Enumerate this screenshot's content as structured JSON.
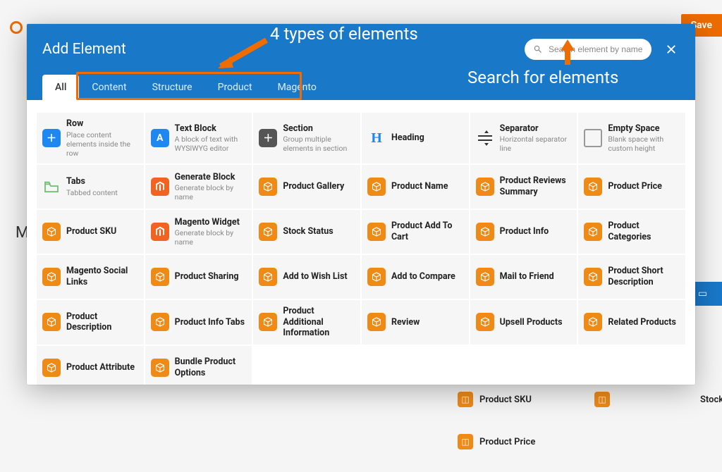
{
  "bg": {
    "save_label": "Save",
    "letter": "M",
    "items": [
      "Product SKU",
      "Stock",
      "Product Price"
    ]
  },
  "modal": {
    "title": "Add Element",
    "search_placeholder": "Search element by name",
    "tabs": [
      {
        "label": "All"
      },
      {
        "label": "Content"
      },
      {
        "label": "Structure"
      },
      {
        "label": "Product"
      },
      {
        "label": "Magento"
      }
    ]
  },
  "annotations": {
    "types_label": "4 types of elements",
    "search_label": "Search for elements"
  },
  "elements": [
    {
      "icon": "plus-blue",
      "title": "Row",
      "sub": "Place content elements inside the row"
    },
    {
      "icon": "A-blue",
      "title": "Text Block",
      "sub": "A block of text with WYSIWYG editor"
    },
    {
      "icon": "plus-dark",
      "title": "Section",
      "sub": "Group multiple elements in section"
    },
    {
      "icon": "H",
      "title": "Heading",
      "sub": ""
    },
    {
      "icon": "separator",
      "title": "Separator",
      "sub": "Horizontal separator line"
    },
    {
      "icon": "outline",
      "title": "Empty Space",
      "sub": "Blank space with custom height"
    },
    {
      "icon": "folder",
      "title": "Tabs",
      "sub": "Tabbed content"
    },
    {
      "icon": "magento",
      "title": "Generate Block",
      "sub": "Generate block by name"
    },
    {
      "icon": "box",
      "title": "Product Gallery",
      "sub": ""
    },
    {
      "icon": "box",
      "title": "Product Name",
      "sub": ""
    },
    {
      "icon": "box",
      "title": "Product Reviews Summary",
      "sub": ""
    },
    {
      "icon": "box",
      "title": "Product Price",
      "sub": ""
    },
    {
      "icon": "box",
      "title": "Product SKU",
      "sub": ""
    },
    {
      "icon": "magento",
      "title": "Magento Widget",
      "sub": "Generate block by name"
    },
    {
      "icon": "box",
      "title": "Stock Status",
      "sub": ""
    },
    {
      "icon": "box",
      "title": "Product Add To Cart",
      "sub": ""
    },
    {
      "icon": "box",
      "title": "Product Info",
      "sub": ""
    },
    {
      "icon": "box",
      "title": "Product Categories",
      "sub": ""
    },
    {
      "icon": "box",
      "title": "Magento Social Links",
      "sub": ""
    },
    {
      "icon": "box",
      "title": "Product Sharing",
      "sub": ""
    },
    {
      "icon": "box",
      "title": "Add to Wish List",
      "sub": ""
    },
    {
      "icon": "box",
      "title": "Add to Compare",
      "sub": ""
    },
    {
      "icon": "box",
      "title": "Mail to Friend",
      "sub": ""
    },
    {
      "icon": "box",
      "title": "Product Short Description",
      "sub": ""
    },
    {
      "icon": "box",
      "title": "Product Description",
      "sub": ""
    },
    {
      "icon": "box",
      "title": "Product Info Tabs",
      "sub": ""
    },
    {
      "icon": "box",
      "title": "Product Additional Information",
      "sub": ""
    },
    {
      "icon": "box",
      "title": "Review",
      "sub": ""
    },
    {
      "icon": "box",
      "title": "Upsell Products",
      "sub": ""
    },
    {
      "icon": "box",
      "title": "Related Products",
      "sub": ""
    },
    {
      "icon": "box",
      "title": "Product Attribute",
      "sub": ""
    },
    {
      "icon": "box",
      "title": "Bundle Product Options",
      "sub": ""
    }
  ]
}
